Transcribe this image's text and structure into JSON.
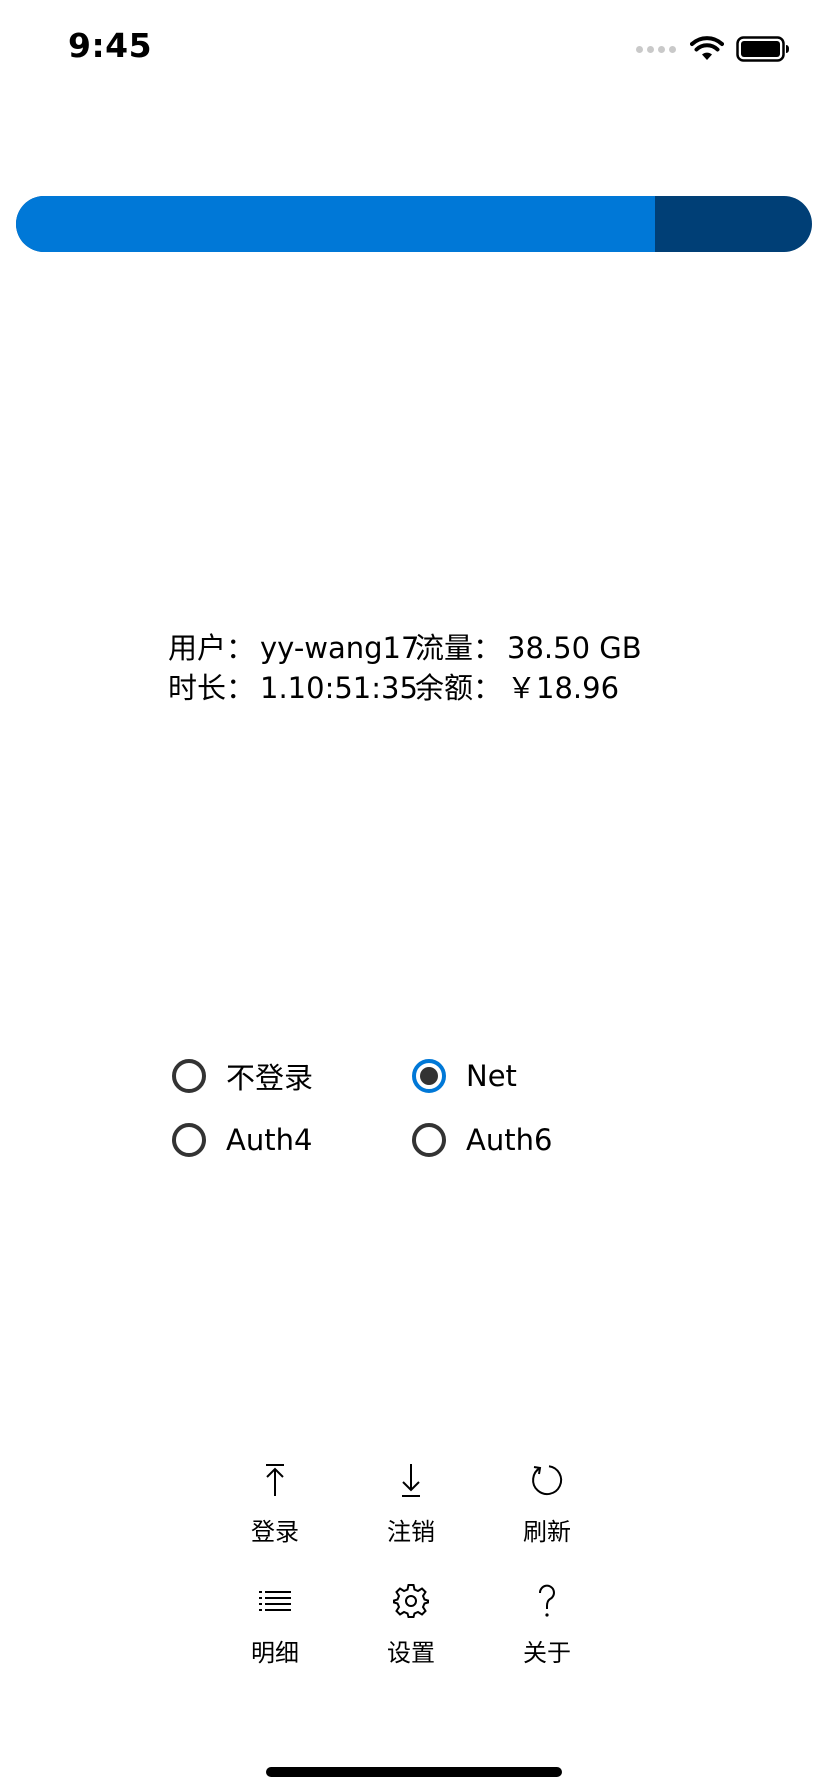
{
  "status_bar": {
    "time": "9:45",
    "icons": [
      "signal-dots-icon",
      "wifi-icon",
      "battery-icon"
    ]
  },
  "usage_bar": {
    "used_fraction": 0.803,
    "fill_color": "#0078d7",
    "remaining_color": "#003f76"
  },
  "info": {
    "user_label": "用户：",
    "user_value": "yy-wang17",
    "traffic_label": "流量：",
    "traffic_value": "38.50 GB",
    "duration_label": "时长：",
    "duration_value": "1.10:51:35",
    "balance_label": "余额：",
    "balance_value": "￥18.96"
  },
  "mode_options": [
    {
      "label": "不登录",
      "checked": false
    },
    {
      "label": "Net",
      "checked": true
    },
    {
      "label": "Auth4",
      "checked": false
    },
    {
      "label": "Auth6",
      "checked": false
    }
  ],
  "actions": [
    {
      "label": "登录",
      "icon": "arrow-up-to-line-icon"
    },
    {
      "label": "注销",
      "icon": "arrow-down-to-line-icon"
    },
    {
      "label": "刷新",
      "icon": "refresh-icon"
    },
    {
      "label": "明细",
      "icon": "list-icon"
    },
    {
      "label": "设置",
      "icon": "gear-icon"
    },
    {
      "label": "关于",
      "icon": "question-mark-icon"
    }
  ],
  "colors": {
    "accent": "#0078d7",
    "accent_dark": "#003f76",
    "radio_border": "#333333"
  }
}
